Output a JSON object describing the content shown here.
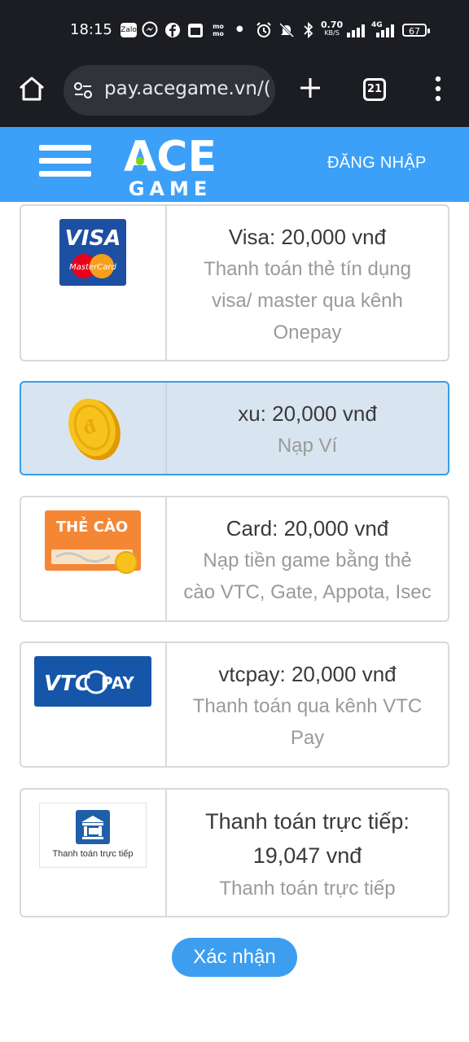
{
  "status_bar": {
    "time": "18:15",
    "notif_zalo": "Zalo",
    "notif_momo": "mo mo",
    "net_speed": "0.70",
    "net_unit": "KB/S",
    "net_type": "4G",
    "battery": "67"
  },
  "browser": {
    "url": "pay.acegame.vn/(",
    "tab_count": "21"
  },
  "site_header": {
    "logo_top": "ACE",
    "logo_bottom": "GAME",
    "login_label": "ĐĂNG NHẬP"
  },
  "payment_methods": [
    {
      "title": "Visa: 20,000 vnđ",
      "desc_lines": [
        "Thanh toán thẻ tín dụng",
        "visa/ master qua kênh",
        "Onepay"
      ],
      "logo_text_1": "VISA",
      "logo_text_2": "MasterCard",
      "selected": false
    },
    {
      "title": "xu: 20,000 vnđ",
      "desc_lines": [
        "Nạp Ví"
      ],
      "selected": true
    },
    {
      "title": "Card: 20,000 vnđ",
      "desc_lines": [
        "Nạp tiền game bằng thẻ",
        "cào VTC, Gate, Appota, Isec"
      ],
      "logo_text_1": "THẺ CÀO",
      "selected": false
    },
    {
      "title": "vtcpay: 20,000 vnđ",
      "desc_lines": [
        "Thanh toán qua kênh VTC",
        "Pay"
      ],
      "logo_text_1": "VTC",
      "logo_text_2": "PAY",
      "selected": false
    },
    {
      "title_lines": [
        "Thanh toán trực tiếp:",
        "19,047 vnđ"
      ],
      "desc_lines": [
        "Thanh toán trực tiếp"
      ],
      "logo_text_1": "Thanh toán trực tiếp",
      "selected": false
    }
  ],
  "confirm_label": "Xác nhận",
  "colors": {
    "header_blue": "#3ca0f8",
    "selected_bg": "#d8e5f0",
    "selected_border": "#3c9ce8",
    "button_blue": "#3d9ef0",
    "status_bg": "#1b1d22"
  }
}
